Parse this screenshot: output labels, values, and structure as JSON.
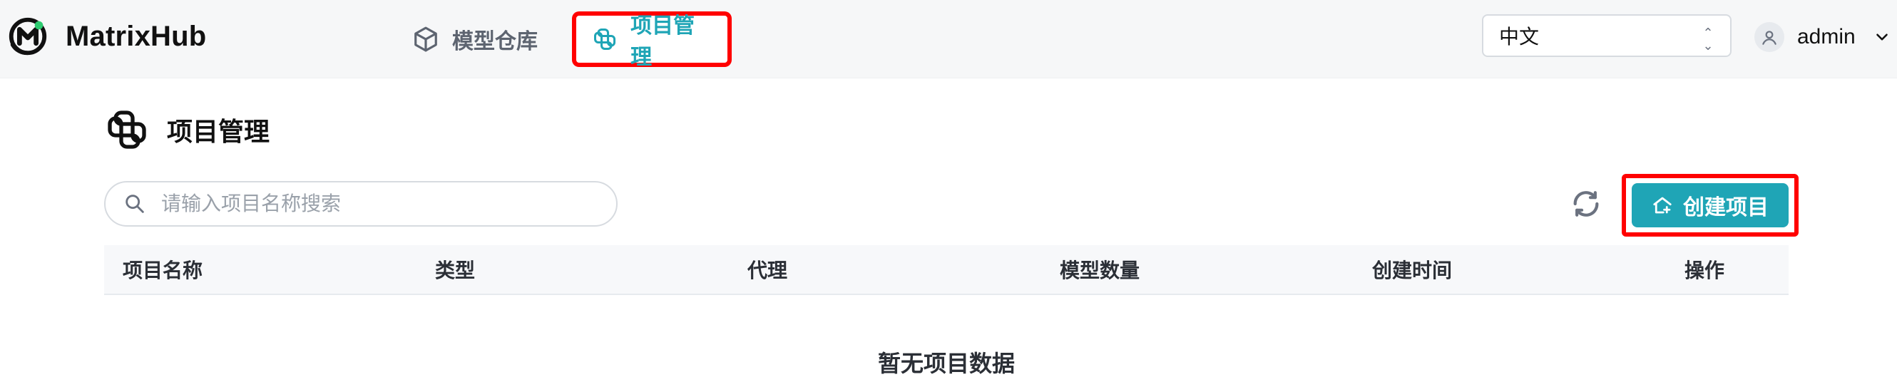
{
  "header": {
    "brand": {
      "name": "MatrixHub"
    },
    "nav": [
      {
        "label": "模型仓库",
        "icon": "cube-icon",
        "active": false
      },
      {
        "label": "项目管理",
        "icon": "project-icon",
        "active": true
      }
    ],
    "language": {
      "selected": "中文"
    },
    "user": {
      "name": "admin"
    }
  },
  "page": {
    "title": "项目管理",
    "search": {
      "placeholder": "请输入项目名称搜索",
      "value": ""
    },
    "actions": {
      "refresh_icon": "refresh-icon",
      "create_label": "创建项目",
      "create_icon": "home-plus-icon"
    },
    "table": {
      "columns": [
        "项目名称",
        "类型",
        "代理",
        "模型数量",
        "创建时间",
        "操作"
      ],
      "empty_text": "暂无项目数据"
    }
  },
  "colors": {
    "accent": "#1fa5b6",
    "highlight": "#ff0000"
  }
}
